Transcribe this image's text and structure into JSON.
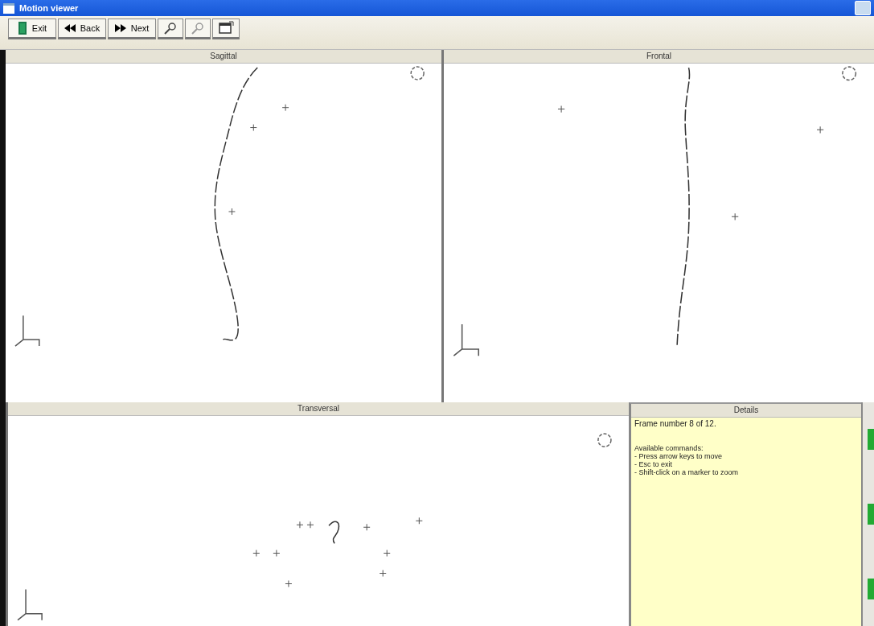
{
  "window": {
    "title": "Motion viewer"
  },
  "toolbar": [
    {
      "kind": "exit",
      "label": "Exit"
    },
    {
      "kind": "back",
      "label": "Back"
    },
    {
      "kind": "next",
      "label": "Next"
    },
    {
      "kind": "zoom_in"
    },
    {
      "kind": "zoom_out"
    },
    {
      "kind": "view"
    }
  ],
  "views": [
    {
      "title": "Sagittal"
    },
    {
      "title": "Frontal"
    },
    {
      "title": "Transversal"
    }
  ],
  "details": {
    "title": "Details",
    "lines": [
      "Frame number 8 of 12.",
      "Available commands:",
      "- Press arrow keys to move",
      "- Esc to exit",
      "- Shift-click on a marker to zoom"
    ]
  }
}
